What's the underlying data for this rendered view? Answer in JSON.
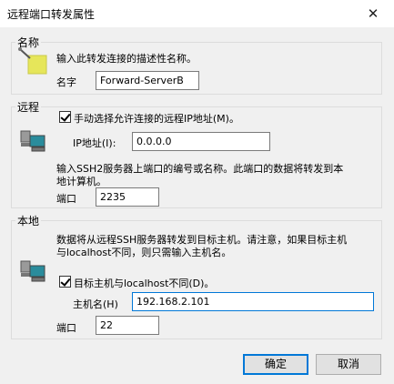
{
  "window": {
    "title": "远程端口转发属性",
    "close_glyph": "✕"
  },
  "name_group": {
    "legend": "名称",
    "description": "输入此转发连接的描述性名称。",
    "name_label": "名字",
    "name_value": "Forward-ServerB"
  },
  "remote_group": {
    "legend": "远程",
    "manual_ip_checkbox": {
      "label": "手动选择允许连接的远程IP地址(M)。",
      "checked": true
    },
    "ip_label": "IP地址(I):",
    "ip_value": "0.0.0.0",
    "description_line1": "输入SSH2服务器上端口的编号或名称。此端口的数据将转发到本",
    "description_line2": "地计算机。",
    "port_label": "端口",
    "port_value": "2235"
  },
  "local_group": {
    "legend": "本地",
    "description_line1": "数据将从远程SSH服务器转发到目标主机。请注意，如果目标主机",
    "description_line2": "与localhost不同，则只需输入主机名。",
    "target_checkbox": {
      "label": "目标主机与localhost不同(D)。",
      "checked": true
    },
    "host_label": "主机名(H)",
    "host_value": "192.168.2.101",
    "port_label": "端口",
    "port_value": "22"
  },
  "buttons": {
    "ok": "确定",
    "cancel": "取消"
  },
  "icons": {
    "name": "name-tag-pencil-icon",
    "remote": "remote-computer-icon",
    "local": "local-computer-icon",
    "close": "close-icon"
  },
  "colors": {
    "accent": "#0078d7",
    "tag": "#e6e65a",
    "monitor_screen": "#2a8c9c"
  }
}
